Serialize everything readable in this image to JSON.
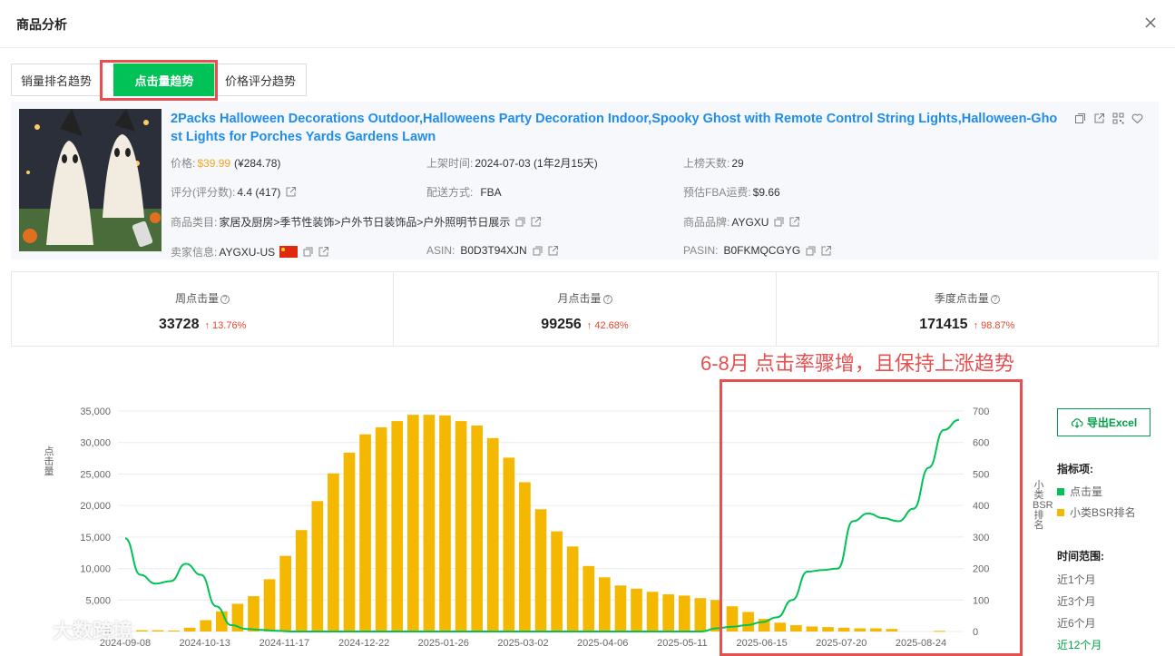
{
  "header": {
    "title": "商品分析"
  },
  "tabs": [
    {
      "label": "销量排名趋势",
      "active": false
    },
    {
      "label": "点击量趋势",
      "active": true
    },
    {
      "label": "价格评分趋势",
      "active": false
    }
  ],
  "product": {
    "title": "2Packs Halloween Decorations Outdoor,Halloweens Party Decoration Indoor,Spooky Ghost with Remote Control String Lights,Halloween-Ghost Lights for Porches Yards Gardens Lawn",
    "price_label": "价格:",
    "price": "$39.99",
    "price_cny": "(¥284.78)",
    "listed_label": "上架时间:",
    "listed": "2024-07-03 (1年2月15天)",
    "days_label": "上榜天数:",
    "days": "29",
    "rating_label": "评分(评分数):",
    "rating": "4.4 (417)",
    "ship_label": "配送方式:",
    "ship": "FBA",
    "fba_label": "预估FBA运费:",
    "fba": "$9.66",
    "category_label": "商品类目:",
    "category": "家居及厨房>季节性装饰>户外节日装饰品>户外照明节日展示",
    "brand_label": "商品品牌:",
    "brand": "AYGXU",
    "seller_label": "卖家信息:",
    "seller": "AYGXU-US",
    "asin_label": "ASIN:",
    "asin": "B0D3T94XJN",
    "pasin_label": "PASIN:",
    "pasin": "B0FKMQCGYG"
  },
  "stats": [
    {
      "label": "周点击量",
      "value": "33728",
      "change": "13.76%"
    },
    {
      "label": "月点击量",
      "value": "99256",
      "change": "42.68%"
    },
    {
      "label": "季度点击量",
      "value": "171415",
      "change": "98.87%"
    }
  ],
  "annotation": "6-8月 点击率骤增，且保持上涨趋势",
  "export_label": "导出Excel",
  "panel": {
    "indicators_title": "指标项:",
    "indicators": [
      {
        "label": "点击量",
        "color": "#00c257"
      },
      {
        "label": "小类BSR排名",
        "color": "#f5b800"
      }
    ],
    "range_title": "时间范围:",
    "ranges": [
      "近1个月",
      "近3个月",
      "近6个月",
      "近12个月"
    ],
    "range_selected": "近12个月"
  },
  "watermark": "大数跨境",
  "chart_data": {
    "type": "bar+line",
    "ylabel_left": "点击量",
    "ylabel_right": "小类BSR排名",
    "ylim_left": [
      0,
      35000
    ],
    "ylim_right": [
      0,
      700
    ],
    "yticks_left": [
      "0",
      "5,000",
      "10,000",
      "15,000",
      "20,000",
      "25,000",
      "30,000",
      "35,000"
    ],
    "yticks_right": [
      "0",
      "100",
      "200",
      "300",
      "400",
      "500",
      "600",
      "700"
    ],
    "xticks": [
      "2024-09-08",
      "2024-10-13",
      "2024-11-17",
      "2024-12-22",
      "2025-01-26",
      "2025-03-02",
      "2025-04-06",
      "2025-05-11",
      "2025-06-15",
      "2025-07-20",
      "2025-08-24"
    ],
    "series": [
      {
        "name": "点击量",
        "kind": "bar",
        "color": "#f5b800",
        "values": [
          0,
          200,
          200,
          150,
          600,
          1800,
          3200,
          4400,
          5600,
          8300,
          12000,
          16100,
          20700,
          25100,
          28400,
          31300,
          32400,
          33400,
          34400,
          34400,
          34300,
          33400,
          32700,
          30700,
          27600,
          23700,
          19400,
          15900,
          13500,
          10400,
          8600,
          7300,
          6800,
          6300,
          5900,
          5700,
          5300,
          5000,
          4000,
          3100,
          2000,
          1400,
          1000,
          800,
          700,
          600,
          500,
          500,
          400,
          0,
          0,
          100,
          0
        ]
      },
      {
        "name": "小类BSR排名",
        "kind": "line",
        "color": "#00c257",
        "values": [
          296,
          180,
          152,
          160,
          215,
          180,
          80,
          20,
          8,
          5,
          2,
          0,
          0,
          0,
          0,
          0,
          0,
          0,
          0,
          0,
          0,
          0,
          0,
          0,
          0,
          0,
          0,
          0,
          0,
          0,
          0,
          0,
          0,
          0,
          0,
          0,
          0,
          0,
          0,
          10,
          15,
          20,
          30,
          45,
          100,
          190,
          195,
          200,
          350,
          375,
          360,
          350,
          390,
          520,
          640,
          672
        ]
      }
    ]
  }
}
